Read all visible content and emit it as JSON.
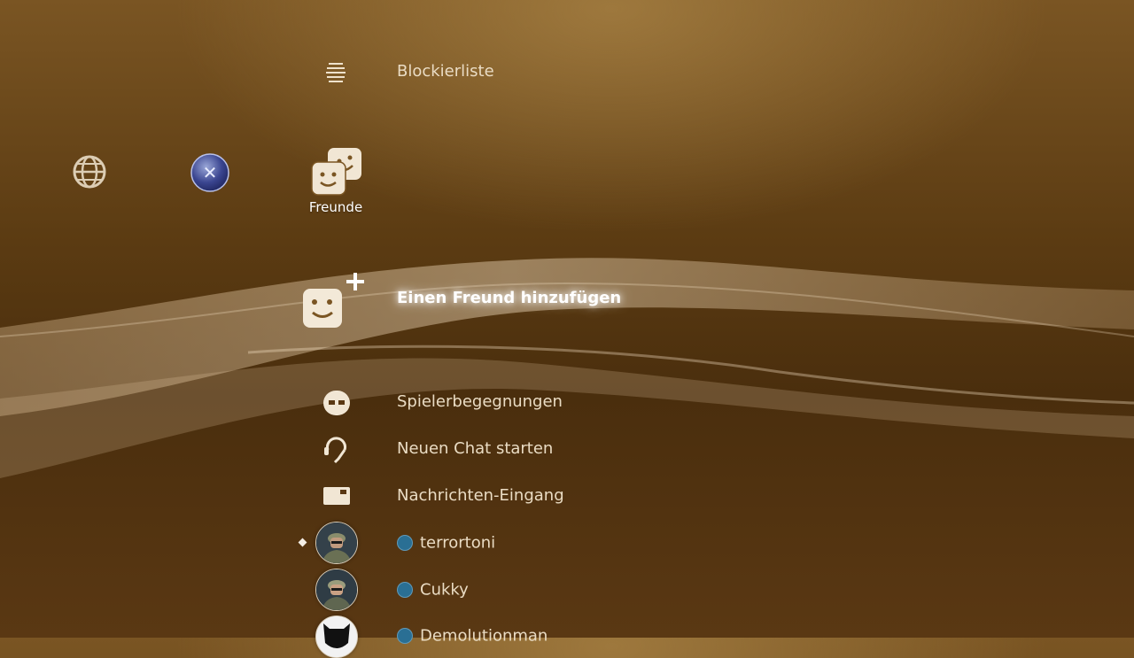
{
  "menu": {
    "above": [
      {
        "label": "Blockierliste",
        "icon": "list-icon"
      }
    ],
    "categories": [
      {
        "name": "network",
        "icon": "globe-icon"
      },
      {
        "name": "playstation-network",
        "icon": "psn-icon"
      },
      {
        "name": "friends",
        "icon": "friends-icon",
        "label": "Freunde"
      }
    ],
    "selected": {
      "label": "Einen Freund hinzufügen",
      "icon": "add-friend-icon"
    },
    "below": [
      {
        "label": "Spielerbegegnungen",
        "icon": "players-met-icon"
      },
      {
        "label": "Neuen Chat starten",
        "icon": "chat-headset-icon"
      },
      {
        "label": "Nachrichten-Eingang",
        "icon": "message-inbox-icon"
      }
    ],
    "friends": [
      {
        "name": "terrortoni",
        "status": "online",
        "icon": "avatar-soldier"
      },
      {
        "name": "Cukky",
        "status": "online",
        "icon": "avatar-soldier"
      },
      {
        "name": "Demolutionman",
        "status": "online",
        "icon": "avatar-mask"
      }
    ]
  },
  "colors": {
    "background_top": "#7a5523",
    "background_bottom": "#4a2e0d",
    "status_online": "#2a6f94",
    "text": "#eadcc4"
  }
}
